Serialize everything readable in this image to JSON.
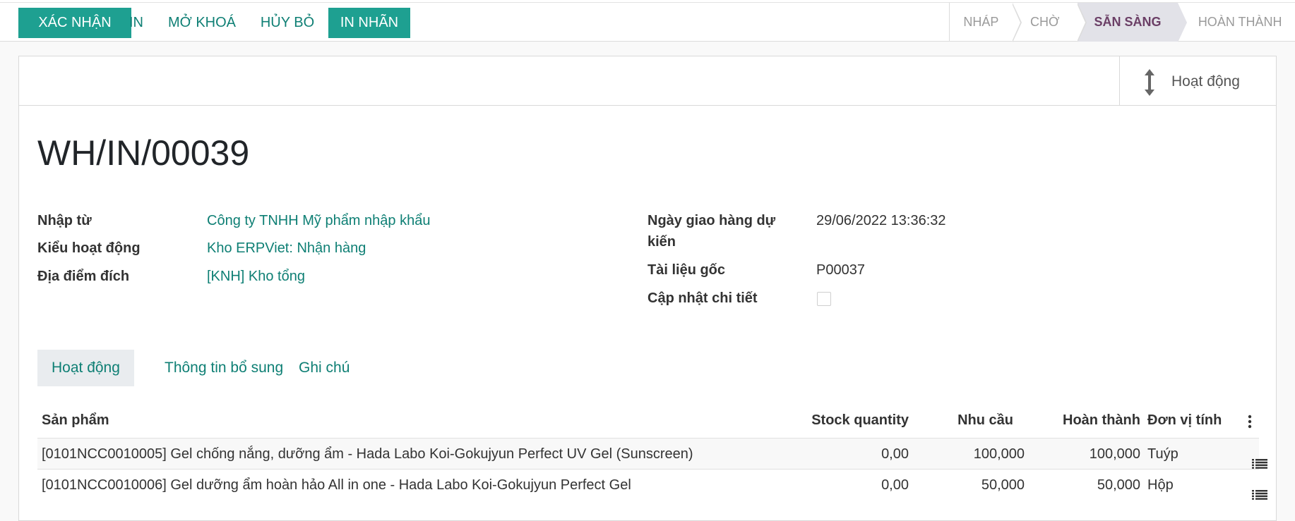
{
  "toolbar": {
    "confirm": "XÁC NHẬN",
    "print": "IN",
    "unlock": "MỞ KHOÁ",
    "cancel": "HỦY BỎ",
    "print_label": "IN NHÃN"
  },
  "statusbar": {
    "stages": [
      {
        "label": "NHÁP",
        "active": false
      },
      {
        "label": "CHỜ",
        "active": false
      },
      {
        "label": "SẴN SÀNG",
        "active": true
      },
      {
        "label": "HOÀN THÀNH",
        "active": false
      }
    ]
  },
  "smart_button": {
    "label": "Hoạt động",
    "icon": "vertical-arrows-icon"
  },
  "record": {
    "title": "WH/IN/00039"
  },
  "fields_left": {
    "partner_label": "Nhập từ",
    "partner_value": "Công ty TNHH Mỹ phẩm nhập khẩu",
    "operation_type_label": "Kiểu hoạt động",
    "operation_type_value": "Kho ERPViet: Nhận hàng",
    "destination_label": "Địa điểm đích",
    "destination_value": "[KNH] Kho tổng"
  },
  "fields_right": {
    "scheduled_label_line1": "Ngày giao hàng dự",
    "scheduled_label_line2": "kiến",
    "scheduled_value": "29/06/2022 13:36:32",
    "source_label": "Tài liệu gốc",
    "source_value": "P00037",
    "update_details_label": "Cập nhật chi tiết",
    "update_details_checked": false
  },
  "tabs": [
    {
      "label": "Hoạt động",
      "active": true
    },
    {
      "label": "Thông tin bổ sung",
      "active": false
    },
    {
      "label": "Ghi chú",
      "active": false
    }
  ],
  "table": {
    "headers": {
      "product": "Sản phẩm",
      "stock_qty": "Stock quantity",
      "demand": "Nhu cầu",
      "done": "Hoàn thành",
      "uom": "Đơn vị tính"
    },
    "rows": [
      {
        "product": "[0101NCC0010005] Gel chống nắng, dưỡng ẩm - Hada Labo Koi-Gokujyun Perfect UV Gel (Sunscreen)",
        "stock_qty": "0,00",
        "demand": "100,000",
        "done": "100,000",
        "uom": "Tuýp"
      },
      {
        "product": "[0101NCC0010006] Gel dưỡng ẩm hoàn hảo All in one - Hada Labo Koi-Gokujyun Perfect Gel",
        "stock_qty": "0,00",
        "demand": "50,000",
        "done": "50,000",
        "uom": "Hộp"
      }
    ]
  },
  "colors": {
    "primary": "#1ea091",
    "link": "#0e7f74",
    "active_stage_text": "#6b3f66"
  }
}
